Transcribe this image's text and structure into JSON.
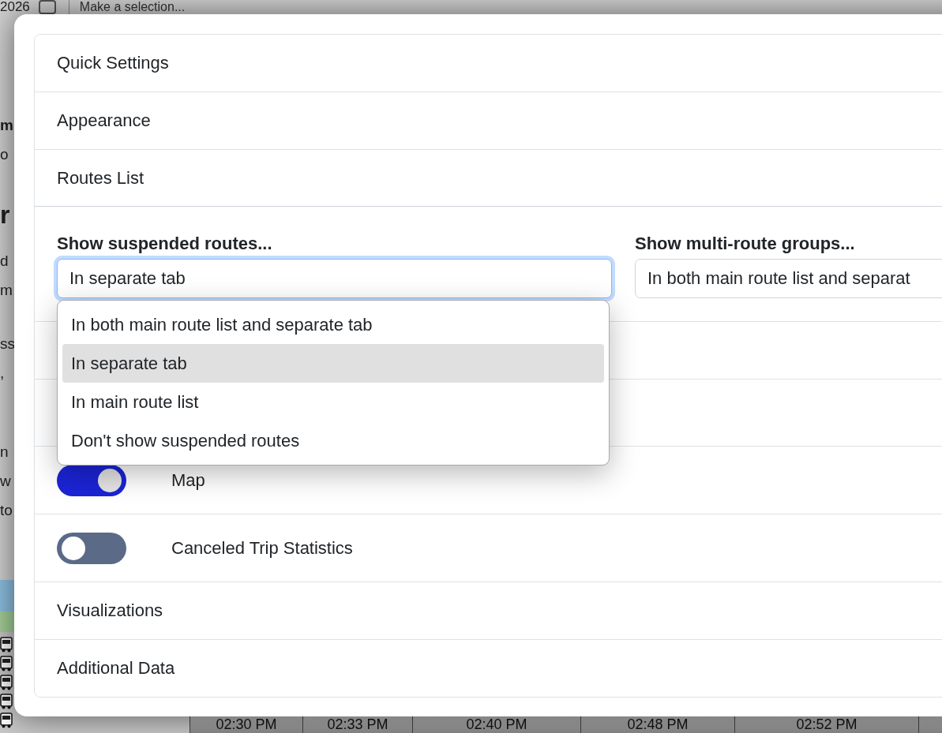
{
  "background_page": {
    "date_text": "2026",
    "checkbox": {
      "checked": false
    },
    "route_select": {
      "placeholder": "Make a selection..."
    },
    "side_text": [
      {
        "kind": "bold",
        "lines": [
          "m"
        ]
      },
      {
        "kind": "text",
        "lines": [
          "o"
        ]
      },
      {
        "kind": "heading",
        "lines": [
          "r"
        ]
      },
      {
        "kind": "text",
        "lines": [
          "d",
          "m"
        ]
      },
      {
        "kind": "text",
        "lines": [
          "ss",
          ","
        ]
      },
      {
        "kind": "text",
        "lines": [
          "n",
          "w",
          "to"
        ]
      }
    ],
    "time_headers": [
      "02:30 PM",
      "02:33 PM",
      "02:40 PM",
      "02:48 PM",
      "02:52 PM"
    ]
  },
  "settings_modal": {
    "sections": [
      {
        "title": "Quick Settings",
        "expanded": false
      },
      {
        "title": "Appearance",
        "expanded": false
      },
      {
        "title": "Routes List",
        "expanded": true,
        "selects": [
          {
            "label": "Show suspended routes...",
            "value": "In separate tab",
            "focused": true,
            "options": [
              {
                "label": "In both main route list and separate tab",
                "selected": false
              },
              {
                "label": "In separate tab",
                "selected": true
              },
              {
                "label": "In main route list",
                "selected": false
              },
              {
                "label": "Don't show suspended routes",
                "selected": false
              }
            ]
          },
          {
            "label": "Show multi-route groups...",
            "value": "In both main route list and separat",
            "focused": false
          }
        ],
        "toggles": [
          {
            "label": "Map",
            "on": true
          },
          {
            "label": "Canceled Trip Statistics",
            "on": false
          }
        ]
      },
      {
        "title": "Visualizations",
        "expanded": false
      },
      {
        "title": "Additional Data",
        "expanded": false
      }
    ]
  }
}
